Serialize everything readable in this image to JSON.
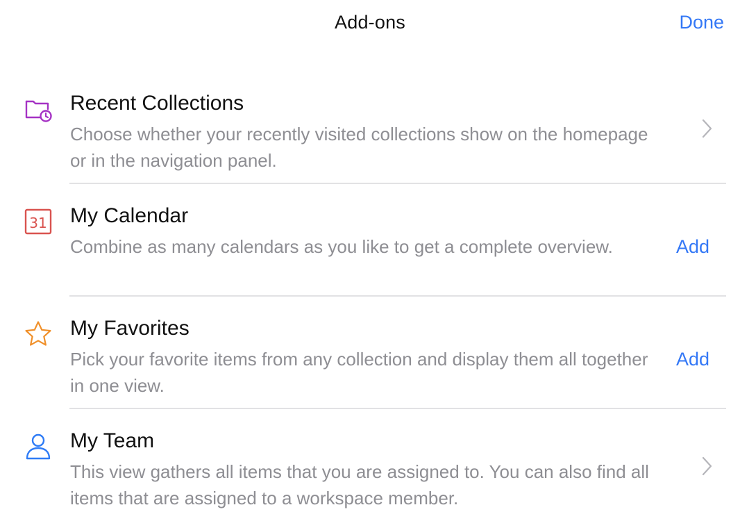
{
  "header": {
    "title": "Add-ons",
    "done_label": "Done"
  },
  "colors": {
    "accent": "#3478f6",
    "title_text": "#111111",
    "secondary_text": "#8e8e93",
    "divider": "#e2e2e4",
    "recent_icon": "#a532c4",
    "calendar_icon": "#d9534f",
    "favorites_icon": "#f0902a",
    "team_icon": "#2f7cf6"
  },
  "addons": [
    {
      "icon": "folder-clock-icon",
      "title": "Recent Collections",
      "description": "Choose whether your recently visited collections show on the homepage or in the navigation panel.",
      "action": "chevron"
    },
    {
      "icon": "calendar-icon",
      "icon_text": "31",
      "title": "My Calendar",
      "description": "Combine as many calendars as you like to get a complete overview.",
      "action": "add",
      "action_label": "Add"
    },
    {
      "icon": "star-icon",
      "title": "My Favorites",
      "description": "Pick your favorite items from any collection and display them all together in one view.",
      "action": "add",
      "action_label": "Add"
    },
    {
      "icon": "person-icon",
      "title": "My Team",
      "description": "This view gathers all items that you are assigned to. You can also find all items that are assigned to a workspace member.",
      "action": "chevron"
    }
  ]
}
